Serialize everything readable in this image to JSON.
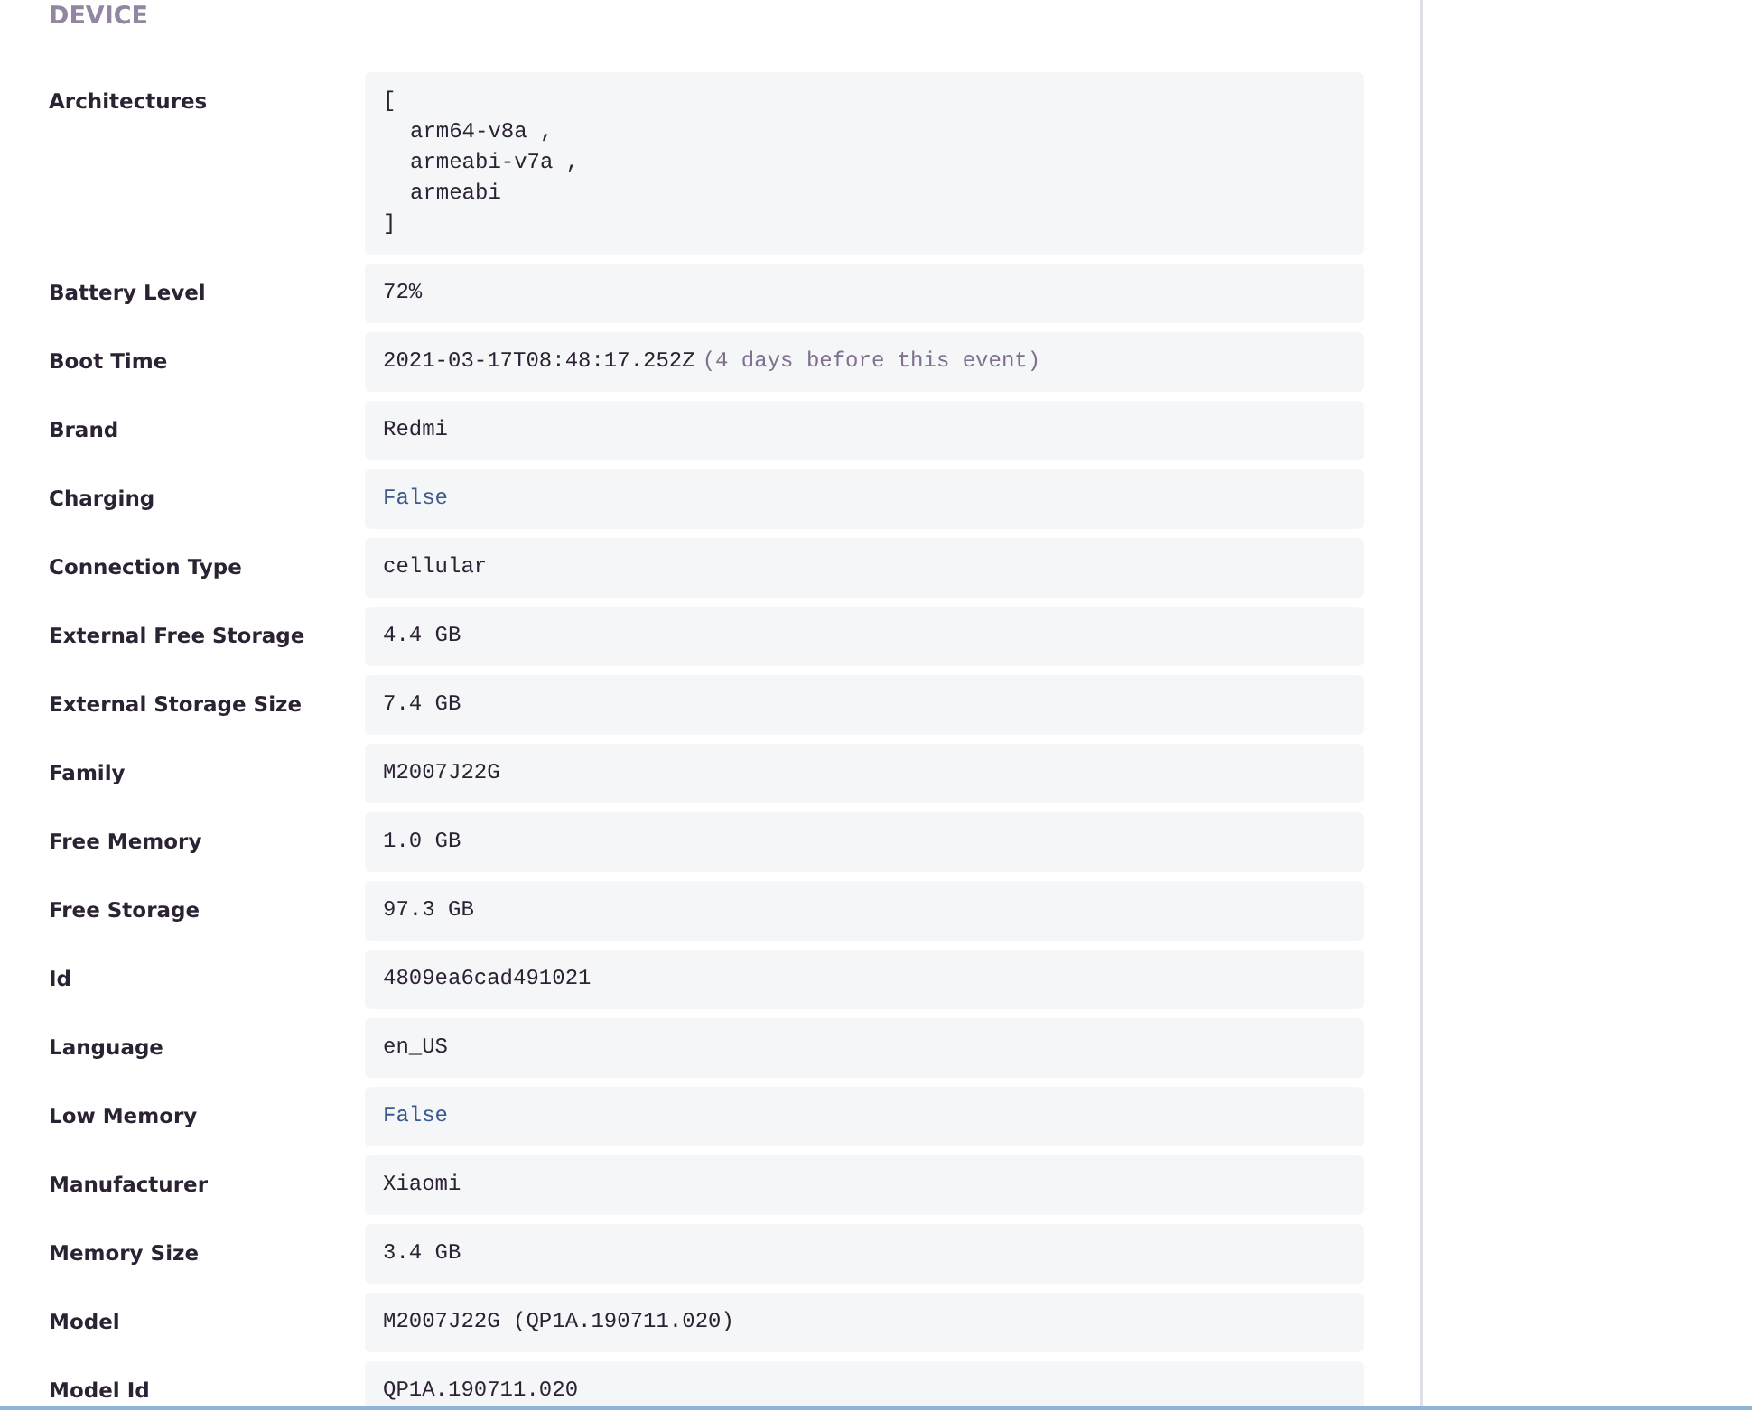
{
  "section": {
    "title": "DEVICE"
  },
  "rows": [
    {
      "label": "Architectures",
      "kind": "list",
      "open": "[",
      "separator": ",",
      "close": "]",
      "items": [
        "arm64-v8a",
        "armeabi-v7a",
        "armeabi"
      ]
    },
    {
      "label": "Battery Level",
      "kind": "text",
      "value": "72%"
    },
    {
      "label": "Boot Time",
      "kind": "text",
      "value": "2021-03-17T08:48:17.252Z",
      "note": "(4 days before this event)"
    },
    {
      "label": "Brand",
      "kind": "text",
      "value": "Redmi"
    },
    {
      "label": "Charging",
      "kind": "boolean",
      "value": "False"
    },
    {
      "label": "Connection Type",
      "kind": "text",
      "value": "cellular"
    },
    {
      "label": "External Free Storage",
      "kind": "text",
      "value": "4.4 GB"
    },
    {
      "label": "External Storage Size",
      "kind": "text",
      "value": "7.4 GB"
    },
    {
      "label": "Family",
      "kind": "text",
      "value": "M2007J22G"
    },
    {
      "label": "Free Memory",
      "kind": "text",
      "value": "1.0 GB"
    },
    {
      "label": "Free Storage",
      "kind": "text",
      "value": "97.3 GB"
    },
    {
      "label": "Id",
      "kind": "text",
      "value": "4809ea6cad491021"
    },
    {
      "label": "Language",
      "kind": "text",
      "value": "en_US"
    },
    {
      "label": "Low Memory",
      "kind": "boolean",
      "value": "False"
    },
    {
      "label": "Manufacturer",
      "kind": "text",
      "value": "Xiaomi"
    },
    {
      "label": "Memory Size",
      "kind": "text",
      "value": "3.4 GB"
    },
    {
      "label": "Model",
      "kind": "text",
      "value": "M2007J22G (QP1A.190711.020)"
    },
    {
      "label": "Model Id",
      "kind": "text",
      "value": "QP1A.190711.020"
    }
  ]
}
